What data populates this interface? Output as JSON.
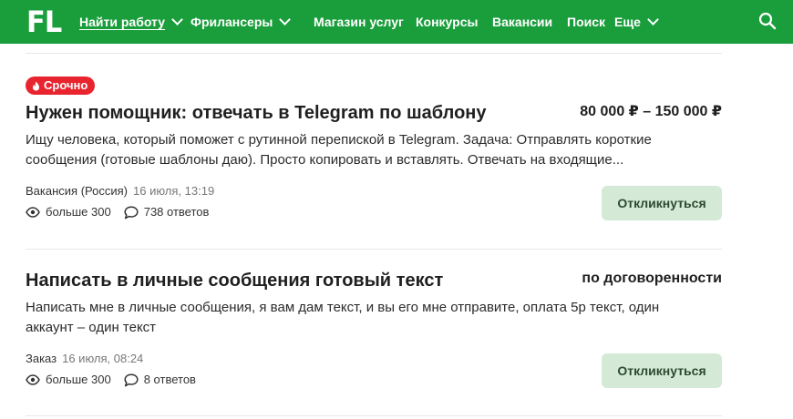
{
  "header": {
    "logo": "FL",
    "nav": [
      {
        "label": "Найти работу",
        "dropdown": true,
        "active": true
      },
      {
        "label": "Фрилансеры",
        "dropdown": true
      },
      {
        "label": "Магазин услуг"
      },
      {
        "label": "Конкурсы"
      },
      {
        "label": "Вакансии"
      },
      {
        "label": "Поиск"
      },
      {
        "label": "Еще",
        "dropdown": true
      }
    ],
    "search_icon": "search-icon"
  },
  "colors": {
    "header_bg": "#1a9e3c",
    "urgent_badge": "#e8252f",
    "reply_button_bg": "#d4ead6"
  },
  "projects": [
    {
      "badge": "Срочно",
      "title": "Нужен помощник: отвечать в Telegram по шаблону",
      "price": "80 000 ₽ – 150 000 ₽",
      "description": "Ищу человека, который поможет с рутинной перепиской в Telegram. Задача: Отправлять короткие сообщения (готовые шаблоны даю). Просто копировать и вставлять. Отвечать на входящие...",
      "type": "Вакансия (Россия)",
      "date": "16 июля, 13:19",
      "views": "больше 300",
      "answers": "738 ответов",
      "button": "Откликнуться"
    },
    {
      "title": "Написать в личные сообщения готовый текст",
      "price": "по договоренности",
      "description": "Написать мне в личные сообщения, я вам дам текст, и вы его мне отправите, оплата 5р текст, один аккаунт – один текст",
      "type": "Заказ",
      "date": "16 июля, 08:24",
      "views": "больше 300",
      "answers": "8 ответов",
      "button": "Откликнуться"
    }
  ]
}
